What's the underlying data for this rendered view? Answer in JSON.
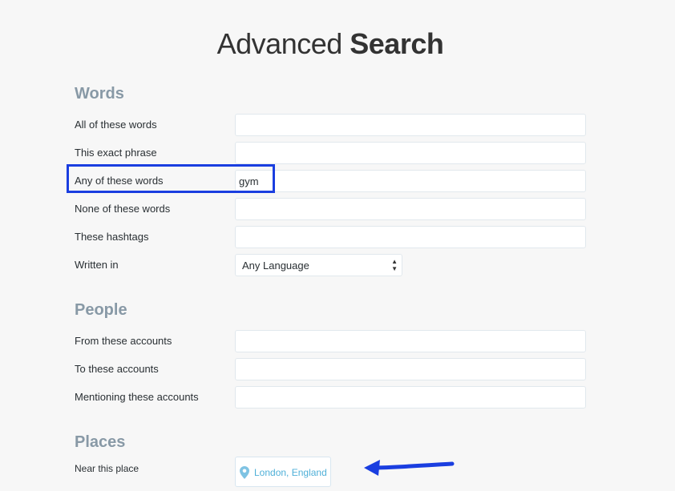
{
  "title": {
    "part1": "Advanced ",
    "part2": "Search"
  },
  "sections": {
    "words": {
      "heading": "Words",
      "all_label": "All of these words",
      "all_value": "",
      "exact_label": "This exact phrase",
      "exact_value": "",
      "any_label": "Any of these words",
      "any_value": "gym",
      "none_label": "None of these words",
      "none_value": "",
      "hashtags_label": "These hashtags",
      "hashtags_value": "",
      "language_label": "Written in",
      "language_value": "Any Language"
    },
    "people": {
      "heading": "People",
      "from_label": "From these accounts",
      "from_value": "",
      "to_label": "To these accounts",
      "to_value": "",
      "mention_label": "Mentioning these accounts",
      "mention_value": ""
    },
    "places": {
      "heading": "Places",
      "near_label": "Near this place",
      "near_value": "London, England"
    }
  },
  "colors": {
    "heading": "#8899a6",
    "highlight": "#1a3ee0",
    "arrow": "#1a3ee0",
    "place_text": "#4fb0d8"
  },
  "icons": {
    "place": "map-pin-icon",
    "select": "sort-arrows-icon"
  }
}
